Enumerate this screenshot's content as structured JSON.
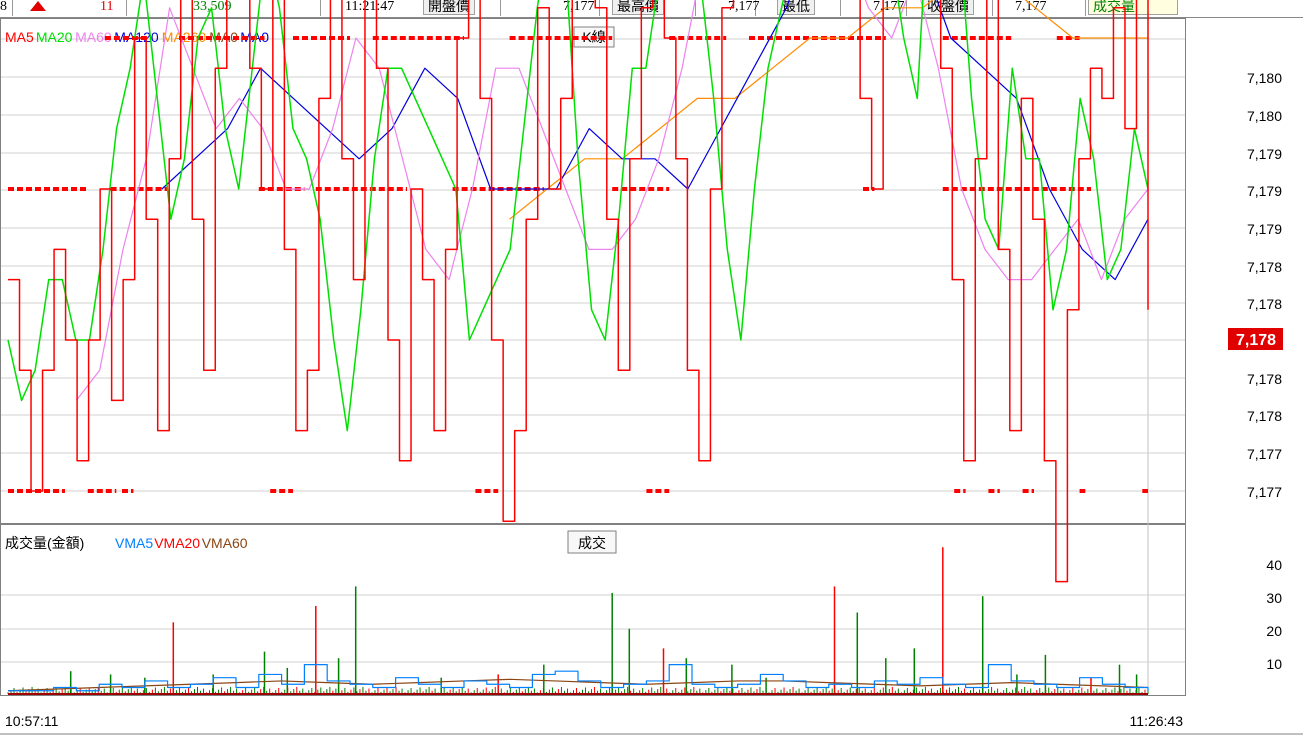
{
  "topbar": {
    "cells": [
      {
        "text": "8",
        "x": 0,
        "color": "#000"
      },
      {
        "text": "11",
        "x": 100,
        "color": "#e00000"
      },
      {
        "text": "33,509",
        "x": 193,
        "color": "#008000"
      },
      {
        "text": "11:21:47",
        "x": 345,
        "color": "#000"
      }
    ],
    "buttons": [
      {
        "label": "開盤價",
        "x": 423,
        "value": "7,177",
        "vx": 563
      },
      {
        "label": "最高價",
        "x": 612,
        "value": "7,177",
        "vx": 728
      },
      {
        "label": "最低",
        "x": 777,
        "value": "7,177",
        "vx": 873
      },
      {
        "label": "收盤價",
        "x": 922,
        "value": "7,177",
        "vx": 1015
      }
    ],
    "volume_button": "成交量",
    "up_arrow_color": "#e00000"
  },
  "colors": {
    "k": "#ff0000",
    "ma20": "#00e000",
    "ma60": "#ee82ee",
    "ma120": "#0000dd",
    "ma260": "#ff8c00",
    "vol_up": "#ff0000",
    "vol_down": "#008000",
    "vma5": "#0080ff",
    "vma20": "#ff0000",
    "vma60": "#8b4513"
  },
  "chart_data": [
    {
      "type": "line",
      "legend": [
        {
          "name": "MA5",
          "color": "#ff0000"
        },
        {
          "name": "MA20",
          "color": "#00e000"
        },
        {
          "name": "MA60",
          "color": "#ee82ee"
        },
        {
          "name": "MA120",
          "color": "#0000dd"
        },
        {
          "name": "MA260",
          "color": "#ff8c00"
        },
        {
          "name": "MA0",
          "color": "#8b4513"
        },
        {
          "name": "MA0",
          "color": "#0000dd"
        }
      ],
      "panel_button": "K線",
      "y_tick_labels": [
        "7,180",
        "7,180",
        "7,179",
        "7,179",
        "7,179",
        "7,178",
        "7,178",
        "7,178",
        "7,178",
        "7,177",
        "7,177"
      ],
      "current_price": "7,178",
      "x_labels": {
        "start": "10:57:11",
        "end": "11:26:43"
      },
      "levels": [
        7177.0,
        7177.5,
        7178.0,
        7178.5,
        7179.0,
        7179.5
      ],
      "level_runs": [
        {
          "level": 7179.5,
          "runs": [
            [
              0.37,
              0.38
            ],
            [
              0.59,
              0.62
            ],
            [
              0.63,
              0.72
            ],
            [
              0.77,
              0.83
            ],
            [
              0.85,
              0.86
            ]
          ]
        },
        {
          "level": 7179.0,
          "runs": [
            [
              0.085,
              0.125
            ],
            [
              0.15,
              0.225
            ],
            [
              0.25,
              0.3
            ],
            [
              0.32,
              0.4
            ],
            [
              0.44,
              0.53
            ],
            [
              0.58,
              0.63
            ],
            [
              0.65,
              0.77
            ],
            [
              0.82,
              0.88
            ],
            [
              0.92,
              0.94
            ]
          ]
        },
        {
          "level": 7178.5,
          "runs": [
            [
              0.0,
              0.07
            ],
            [
              0.09,
              0.14
            ],
            [
              0.22,
              0.26
            ],
            [
              0.27,
              0.35
            ],
            [
              0.39,
              0.47
            ],
            [
              0.53,
              0.58
            ],
            [
              0.75,
              0.76
            ],
            [
              0.82,
              0.95
            ]
          ]
        },
        {
          "level": 7177.5,
          "runs": [
            [
              0.0,
              0.05
            ],
            [
              0.07,
              0.095
            ],
            [
              0.1,
              0.11
            ],
            [
              0.23,
              0.25
            ],
            [
              0.41,
              0.43
            ],
            [
              0.56,
              0.58
            ],
            [
              0.83,
              0.84
            ],
            [
              0.86,
              0.87
            ],
            [
              0.89,
              0.9
            ],
            [
              0.94,
              0.945
            ],
            [
              0.995,
              1.0
            ]
          ]
        }
      ],
      "ma5": [
        7178.2,
        7177.9,
        7177.5,
        7177.9,
        7178.3,
        7178.0,
        7177.6,
        7178.0,
        7178.5,
        7177.8,
        7178.2,
        7179.0,
        7178.4,
        7177.7,
        7178.6,
        7179.2,
        7178.4,
        7177.9,
        7178.9,
        7179.5,
        7179.9,
        7178.9,
        7178.5,
        7179.2,
        7178.3,
        7177.7,
        7177.9,
        7178.8,
        7179.4,
        7178.6,
        7178.2,
        7179.3,
        7178.9,
        7178.0,
        7177.6,
        7178.5,
        7178.2,
        7177.7,
        7178.3,
        7179.0,
        7179.6,
        7178.8,
        7178.0,
        7177.4,
        7177.7,
        7178.4,
        7179.1,
        7178.5,
        7178.8,
        7179.2,
        7179.7,
        7179.1,
        7178.4,
        7177.9,
        7178.6,
        7179.1,
        7179.4,
        7179.0,
        7178.6,
        7177.9,
        7177.6,
        7178.5,
        7179.1,
        7179.3,
        7179.5,
        7180.2,
        7179.8,
        7179.9,
        7179.3,
        7180.0,
        7179.7,
        7179.9,
        7179.2,
        7179.4,
        7178.8,
        7178.5,
        7179.3,
        7179.9,
        7180.1,
        7179.4,
        7179.8,
        7178.9,
        7178.2,
        7177.6,
        7178.6,
        7179.3,
        7178.3,
        7177.7,
        7178.8,
        7178.4,
        7177.6,
        7177.2,
        7178.1,
        7178.6,
        7178.9,
        7178.8,
        7179.1,
        7178.7,
        7179.2,
        7178.1
      ],
      "ma20": [
        7178.0,
        7177.8,
        7177.9,
        7178.2,
        7178.2,
        7178.0,
        7178.0,
        7178.3,
        7178.7,
        7178.9,
        7179.2,
        7178.8,
        7178.4,
        7178.6,
        7179.0,
        7179.1,
        7178.7,
        7178.5,
        7178.9,
        7179.3,
        7179.1,
        7178.7,
        7178.6,
        7178.4,
        7178.0,
        7177.7,
        7178.1,
        7178.6,
        7178.9,
        7178.9,
        7178.8,
        7178.7,
        7178.6,
        7178.5,
        7178.0,
        7178.1,
        7178.2,
        7178.3,
        7178.7,
        7179.1,
        7179.4,
        7179.3,
        7178.6,
        7178.1,
        7178.0,
        7178.4,
        7178.9,
        7178.9,
        7179.2,
        7179.3,
        7179.4,
        7179.2,
        7178.8,
        7178.3,
        7178.0,
        7178.5,
        7178.9,
        7179.1,
        7179.3,
        7179.5,
        7179.6,
        7180.1,
        7179.9,
        7179.8,
        7179.6,
        7179.3,
        7179.0,
        7178.8,
        7179.6,
        7179.9,
        7179.4,
        7178.8,
        7178.4,
        7178.3,
        7178.9,
        7178.6,
        7178.6,
        7178.1,
        7178.3,
        7178.8,
        7178.6,
        7178.2,
        7178.3,
        7178.7,
        7178.5
      ],
      "ma60": [
        7177.8,
        7177.9,
        7178.3,
        7178.6,
        7179.1,
        7178.9,
        7178.7,
        7178.8,
        7178.7,
        7178.5,
        7178.5,
        7178.7,
        7179.0,
        7178.9,
        7178.6,
        7178.3,
        7178.2,
        7178.5,
        7178.9,
        7178.9,
        7178.7,
        7178.5,
        7178.3,
        7178.3,
        7178.4,
        7178.6,
        7178.9,
        7179.3,
        7179.7,
        7179.7,
        7179.8,
        7179.6,
        7179.5,
        7179.3,
        7179.1,
        7179.0,
        7179.2,
        7178.9,
        7178.5,
        7178.3,
        7178.2,
        7178.2,
        7178.3,
        7178.4,
        7178.2,
        7178.4,
        7178.5
      ],
      "ma120": [
        7178.5,
        7178.6,
        7178.7,
        7178.9,
        7178.8,
        7178.7,
        7178.6,
        7178.7,
        7178.9,
        7178.8,
        7178.5,
        7178.5,
        7178.5,
        7178.7,
        7178.6,
        7178.6,
        7178.5,
        7178.7,
        7178.9,
        7179.1,
        7179.4,
        7179.4,
        7179.4,
        7179.3,
        7179.0,
        7178.9,
        7178.8,
        7178.5,
        7178.3,
        7178.2,
        7178.4
      ],
      "ma260": [
        7178.4,
        7178.5,
        7178.6,
        7178.6,
        7178.7,
        7178.8,
        7178.8,
        7178.9,
        7179.0,
        7179.0,
        7179.1,
        7179.1,
        7179.2,
        7179.2,
        7179.1,
        7179.0,
        7179.0,
        7179.0
      ]
    },
    {
      "type": "bar",
      "legend": [
        {
          "name": "成交量(金額)",
          "color": "#000000"
        },
        {
          "name": "VMA5",
          "color": "#0080ff"
        },
        {
          "name": "VMA20",
          "color": "#ff0000"
        },
        {
          "name": "VMA60",
          "color": "#8b4513"
        }
      ],
      "panel_button": "成交",
      "y_tick_labels": [
        "10",
        "20",
        "30",
        "40"
      ],
      "ylim": [
        0,
        45
      ],
      "spikes": [
        {
          "x": 0.055,
          "v": 7
        },
        {
          "x": 0.09,
          "v": 6
        },
        {
          "x": 0.12,
          "v": 5
        },
        {
          "x": 0.145,
          "v": 22
        },
        {
          "x": 0.18,
          "v": 6
        },
        {
          "x": 0.225,
          "v": 13
        },
        {
          "x": 0.245,
          "v": 8
        },
        {
          "x": 0.27,
          "v": 27
        },
        {
          "x": 0.29,
          "v": 11
        },
        {
          "x": 0.305,
          "v": 33
        },
        {
          "x": 0.38,
          "v": 5
        },
        {
          "x": 0.43,
          "v": 6
        },
        {
          "x": 0.47,
          "v": 9
        },
        {
          "x": 0.53,
          "v": 31
        },
        {
          "x": 0.545,
          "v": 20
        },
        {
          "x": 0.575,
          "v": 14
        },
        {
          "x": 0.595,
          "v": 11
        },
        {
          "x": 0.635,
          "v": 9
        },
        {
          "x": 0.665,
          "v": 5
        },
        {
          "x": 0.725,
          "v": 33
        },
        {
          "x": 0.745,
          "v": 25
        },
        {
          "x": 0.77,
          "v": 11
        },
        {
          "x": 0.795,
          "v": 14
        },
        {
          "x": 0.82,
          "v": 45
        },
        {
          "x": 0.855,
          "v": 30
        },
        {
          "x": 0.885,
          "v": 6
        },
        {
          "x": 0.91,
          "v": 12
        },
        {
          "x": 0.95,
          "v": 5
        },
        {
          "x": 0.975,
          "v": 9
        },
        {
          "x": 0.99,
          "v": 6
        }
      ],
      "vma5": [
        1,
        1,
        2,
        1,
        3,
        2,
        4,
        2,
        3,
        5,
        2,
        6,
        3,
        9,
        4,
        3,
        2,
        5,
        3,
        2,
        4,
        3,
        2,
        6,
        7,
        4,
        2,
        3,
        4,
        9,
        3,
        2,
        3,
        6,
        4,
        2,
        3,
        2,
        4,
        3,
        5,
        3,
        2,
        9,
        4,
        3,
        2,
        5,
        3,
        2,
        1
      ],
      "vma20": [
        1,
        1.5,
        2,
        2.5,
        3,
        3.5,
        4,
        3.5,
        3,
        3.5,
        4,
        4.5,
        4,
        3.5,
        3,
        3.5,
        4,
        4,
        3.5,
        3,
        2.5,
        3,
        3.5,
        3,
        2.5,
        2
      ]
    }
  ]
}
